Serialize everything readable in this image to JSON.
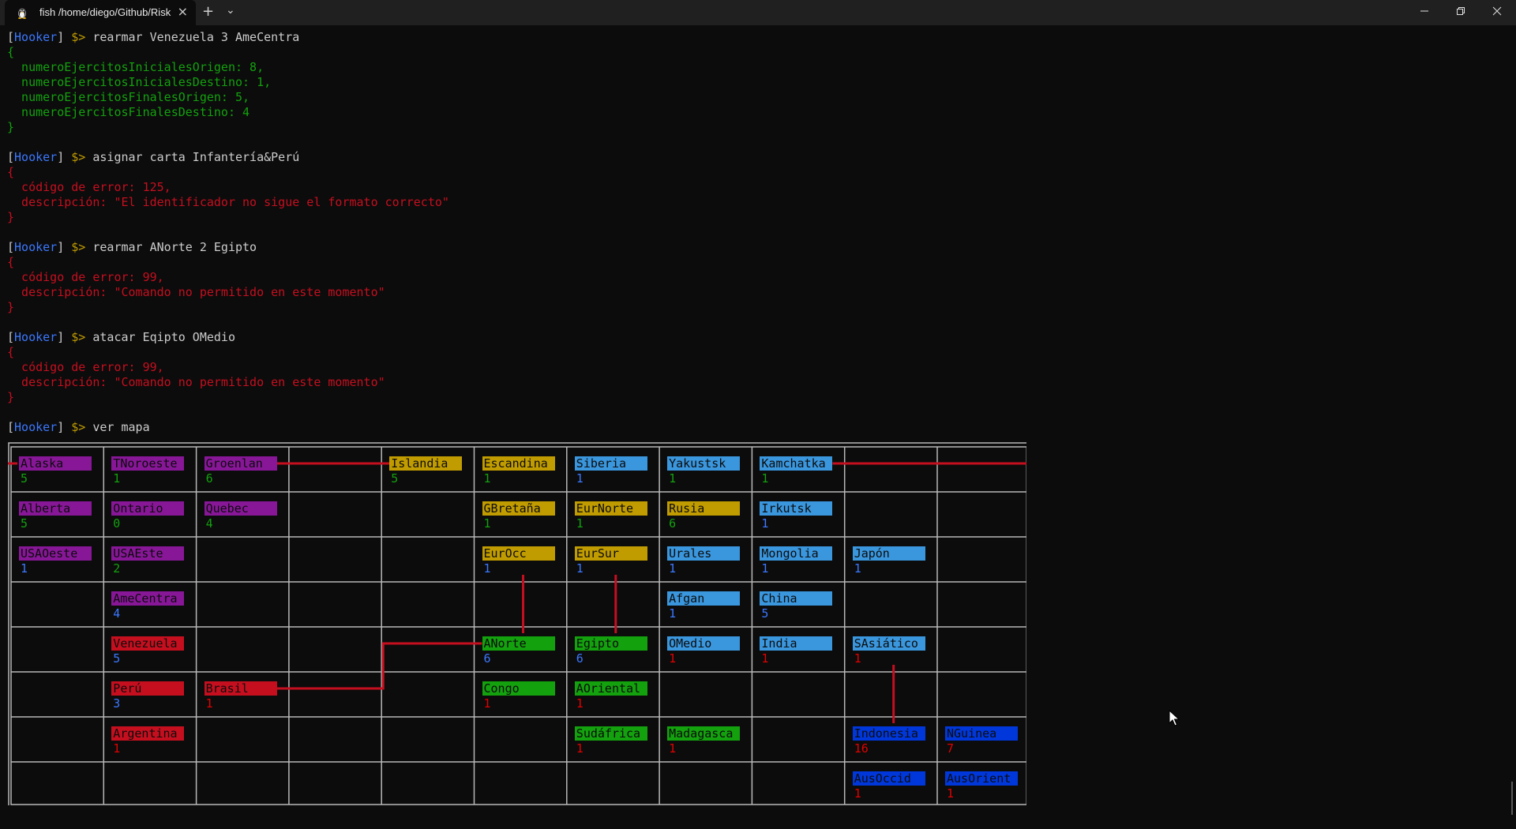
{
  "window": {
    "tab_title": "fish /home/diego/Github/Risk",
    "tab_icon": "linux-tux-icon",
    "close_tab": "×",
    "new_tab": "+",
    "dropdown": "⌄",
    "minimize": "—",
    "maximize": "❐",
    "close": "✕"
  },
  "console": {
    "prompt_user": "Hooker",
    "prompt_symbol": "$>",
    "blocks": [
      {
        "command": "rearmar Venezuela 3 AmeCentra",
        "output_color": "green",
        "lines": [
          "{",
          "  numeroEjercitosInicialesOrigen: 8,",
          "  numeroEjercitosInicialesDestino: 1,",
          "  numeroEjercitosFinalesOrigen: 5,",
          "  numeroEjercitosFinalesDestino: 4",
          "}"
        ]
      },
      {
        "command": "asignar carta Infantería&Perú",
        "output_color": "red",
        "lines": [
          "{",
          "  código de error: 125,",
          "  descripción: \"El identificador no sigue el formato correcto\"",
          "}"
        ]
      },
      {
        "command": "rearmar ANorte 2 Egipto",
        "output_color": "red",
        "lines": [
          "{",
          "  código de error: 99,",
          "  descripción: \"Comando no permitido en este momento\"",
          "}"
        ]
      },
      {
        "command": "atacar Eqipto OMedio",
        "output_color": "red",
        "lines": [
          "{",
          "  código de error: 99,",
          "  descripción: \"Comando no permitido en este momento\"",
          "}"
        ]
      },
      {
        "command": "ver mapa",
        "output_color": "white",
        "lines": []
      }
    ]
  },
  "colors": {
    "north_america": "#881798",
    "south_america": "#c50f1f",
    "europe": "#c19c00",
    "asia": "#3a96dd",
    "africa": "#13a10e",
    "oceania": "#0037da",
    "armies_green": "#13a10e",
    "armies_blue": "#3b78ff",
    "armies_red": "#e30000",
    "connection": "#c50f1f"
  },
  "map": {
    "territories": [
      {
        "name": "Alaska",
        "armies": "5",
        "row": 0,
        "col": 0,
        "fill": "north_america",
        "armies_color": "armies_green"
      },
      {
        "name": "TNoroeste",
        "armies": "1",
        "row": 0,
        "col": 1,
        "fill": "north_america",
        "armies_color": "armies_green"
      },
      {
        "name": "Groenlan",
        "armies": "6",
        "row": 0,
        "col": 2,
        "fill": "north_america",
        "armies_color": "armies_green"
      },
      {
        "name": "Islandia",
        "armies": "5",
        "row": 0,
        "col": 4,
        "fill": "europe",
        "armies_color": "armies_green"
      },
      {
        "name": "Escandina",
        "armies": "1",
        "row": 0,
        "col": 5,
        "fill": "europe",
        "armies_color": "armies_green"
      },
      {
        "name": "Siberia",
        "armies": "1",
        "row": 0,
        "col": 6,
        "fill": "asia",
        "armies_color": "armies_blue"
      },
      {
        "name": "Yakustsk",
        "armies": "1",
        "row": 0,
        "col": 7,
        "fill": "asia",
        "armies_color": "armies_green"
      },
      {
        "name": "Kamchatka",
        "armies": "1",
        "row": 0,
        "col": 8,
        "fill": "asia",
        "armies_color": "armies_green"
      },
      {
        "name": "Alberta",
        "armies": "5",
        "row": 1,
        "col": 0,
        "fill": "north_america",
        "armies_color": "armies_green"
      },
      {
        "name": "Ontario",
        "armies": "0",
        "row": 1,
        "col": 1,
        "fill": "north_america",
        "armies_color": "armies_green"
      },
      {
        "name": "Quebec",
        "armies": "4",
        "row": 1,
        "col": 2,
        "fill": "north_america",
        "armies_color": "armies_green"
      },
      {
        "name": "GBretaña",
        "armies": "1",
        "row": 1,
        "col": 5,
        "fill": "europe",
        "armies_color": "armies_green"
      },
      {
        "name": "EurNorte",
        "armies": "1",
        "row": 1,
        "col": 6,
        "fill": "europe",
        "armies_color": "armies_green"
      },
      {
        "name": "Rusia",
        "armies": "6",
        "row": 1,
        "col": 7,
        "fill": "europe",
        "armies_color": "armies_green"
      },
      {
        "name": "Irkutsk",
        "armies": "1",
        "row": 1,
        "col": 8,
        "fill": "asia",
        "armies_color": "armies_blue"
      },
      {
        "name": "USAOeste",
        "armies": "1",
        "row": 2,
        "col": 0,
        "fill": "north_america",
        "armies_color": "armies_blue"
      },
      {
        "name": "USAEste",
        "armies": "2",
        "row": 2,
        "col": 1,
        "fill": "north_america",
        "armies_color": "armies_green"
      },
      {
        "name": "EurOcc",
        "armies": "1",
        "row": 2,
        "col": 5,
        "fill": "europe",
        "armies_color": "armies_blue"
      },
      {
        "name": "EurSur",
        "armies": "1",
        "row": 2,
        "col": 6,
        "fill": "europe",
        "armies_color": "armies_blue"
      },
      {
        "name": "Urales",
        "armies": "1",
        "row": 2,
        "col": 7,
        "fill": "asia",
        "armies_color": "armies_blue"
      },
      {
        "name": "Mongolia",
        "armies": "1",
        "row": 2,
        "col": 8,
        "fill": "asia",
        "armies_color": "armies_blue"
      },
      {
        "name": "Japón",
        "armies": "1",
        "row": 2,
        "col": 9,
        "fill": "asia",
        "armies_color": "armies_blue"
      },
      {
        "name": "AmeCentra",
        "armies": "4",
        "row": 3,
        "col": 1,
        "fill": "north_america",
        "armies_color": "armies_blue"
      },
      {
        "name": "Afgan",
        "armies": "1",
        "row": 3,
        "col": 7,
        "fill": "asia",
        "armies_color": "armies_blue"
      },
      {
        "name": "China",
        "armies": "5",
        "row": 3,
        "col": 8,
        "fill": "asia",
        "armies_color": "armies_blue"
      },
      {
        "name": "Venezuela",
        "armies": "5",
        "row": 4,
        "col": 1,
        "fill": "south_america",
        "armies_color": "armies_blue"
      },
      {
        "name": "ANorte",
        "armies": "6",
        "row": 4,
        "col": 5,
        "fill": "africa",
        "armies_color": "armies_blue"
      },
      {
        "name": "Egipto",
        "armies": "6",
        "row": 4,
        "col": 6,
        "fill": "africa",
        "armies_color": "armies_blue"
      },
      {
        "name": "OMedio",
        "armies": "1",
        "row": 4,
        "col": 7,
        "fill": "asia",
        "armies_color": "armies_red"
      },
      {
        "name": "India",
        "armies": "1",
        "row": 4,
        "col": 8,
        "fill": "asia",
        "armies_color": "armies_red"
      },
      {
        "name": "SAsiático",
        "armies": "1",
        "row": 4,
        "col": 9,
        "fill": "asia",
        "armies_color": "armies_red"
      },
      {
        "name": "Perú",
        "armies": "3",
        "row": 5,
        "col": 1,
        "fill": "south_america",
        "armies_color": "armies_blue"
      },
      {
        "name": "Brasil",
        "armies": "1",
        "row": 5,
        "col": 2,
        "fill": "south_america",
        "armies_color": "armies_red"
      },
      {
        "name": "Congo",
        "armies": "1",
        "row": 5,
        "col": 5,
        "fill": "africa",
        "armies_color": "armies_red"
      },
      {
        "name": "AOriental",
        "armies": "1",
        "row": 5,
        "col": 6,
        "fill": "africa",
        "armies_color": "armies_red"
      },
      {
        "name": "Argentina",
        "armies": "1",
        "row": 6,
        "col": 1,
        "fill": "south_america",
        "armies_color": "armies_red"
      },
      {
        "name": "Sudáfrica",
        "armies": "1",
        "row": 6,
        "col": 6,
        "fill": "africa",
        "armies_color": "armies_red"
      },
      {
        "name": "Madagasca",
        "armies": "1",
        "row": 6,
        "col": 7,
        "fill": "africa",
        "armies_color": "armies_red"
      },
      {
        "name": "Indonesia",
        "armies": "16",
        "row": 6,
        "col": 9,
        "fill": "oceania",
        "armies_color": "armies_red"
      },
      {
        "name": "NGuinea",
        "armies": "7",
        "row": 6,
        "col": 10,
        "fill": "oceania",
        "armies_color": "armies_red"
      },
      {
        "name": "AusOccid",
        "armies": "1",
        "row": 7,
        "col": 9,
        "fill": "oceania",
        "armies_color": "armies_red"
      },
      {
        "name": "AusOrient",
        "armies": "1",
        "row": 7,
        "col": 10,
        "fill": "oceania",
        "armies_color": "armies_red"
      }
    ]
  }
}
